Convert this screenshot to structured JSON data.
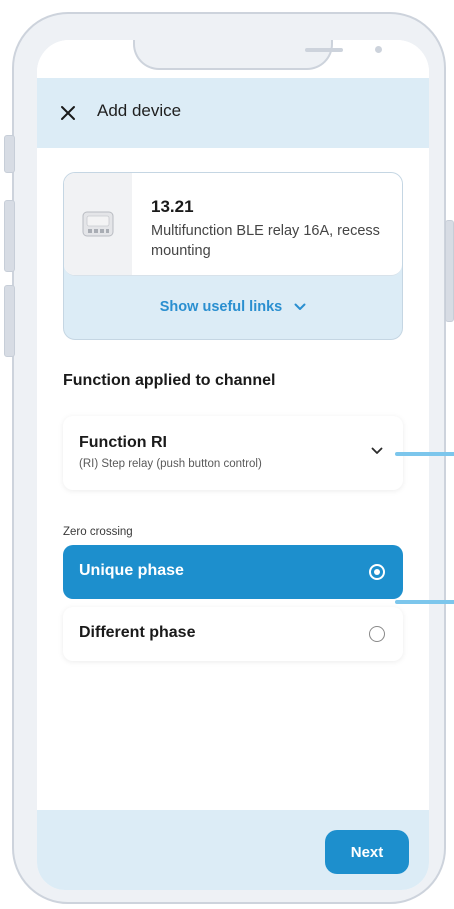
{
  "header": {
    "title": "Add device",
    "close_icon": "close-icon"
  },
  "device": {
    "model": "13.21",
    "description": "Multifunction BLE relay 16A, recess mounting",
    "image_icon": "relay-device-image",
    "links_label": "Show useful links",
    "links_icon": "chevron-down-icon"
  },
  "channel": {
    "section_title": "Function applied to channel",
    "function_name": "Function RI",
    "function_desc": "(RI) Step relay (push button control)",
    "dropdown_icon": "chevron-down-icon"
  },
  "zero_crossing": {
    "label": "Zero crossing",
    "options": [
      {
        "label": "Unique phase",
        "selected": true
      },
      {
        "label": "Different phase",
        "selected": false
      }
    ]
  },
  "footer": {
    "next_label": "Next"
  },
  "colors": {
    "accent": "#1d8fcd",
    "header_bg": "#dcecf6",
    "pointer_line": "#7cc6ec"
  }
}
